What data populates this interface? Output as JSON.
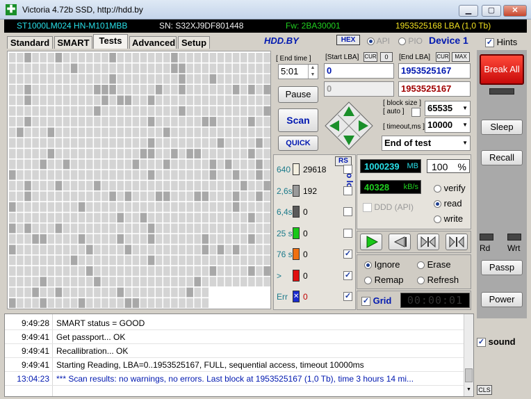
{
  "window": {
    "title": "Victoria 4.72b SSD, http://hdd.by"
  },
  "infobar": {
    "model": "ST1000LM024 HN-M101MBB",
    "serial": "SN: S32XJ9DF801448",
    "firmware": "Fw: 2BA30001",
    "capacity": "1953525168 LBA (1,0 Tb)"
  },
  "tabs": [
    "Standard",
    "SMART",
    "Tests",
    "Advanced",
    "Setup"
  ],
  "active_tab": "Tests",
  "header": {
    "site": "HDD.BY",
    "hex_label": "HEX",
    "api_label": "API",
    "pio_label": "PIO",
    "device_label": "Device 1",
    "hints_label": "Hints"
  },
  "test": {
    "end_time_label": "[ End time ]",
    "end_time_value": "5:01",
    "start_lba_label": "[Start LBA]",
    "cur_label": "CUR",
    "zero_label": "0",
    "end_lba_label": "[End LBA]",
    "max_label": "MAX",
    "start_lba_value": "0",
    "end_lba_value": "1953525167",
    "cur_lba_value": "0",
    "end_lba_value2": "1953525167",
    "pause_label": "Pause",
    "scan_label": "Scan",
    "quick_label": "QUICK",
    "block_size_label": "[ block size ]",
    "auto_label": "[ auto ]",
    "block_size_value": "65535",
    "timeout_label": "[ timeout,ms ]",
    "timeout_value": "10000",
    "end_action": "End of test"
  },
  "stats": {
    "rs_label": "RS",
    "to_log_label": "to log:",
    "rows": [
      {
        "label": "640",
        "count": "29618",
        "color": "#f4f0e0",
        "logged": false
      },
      {
        "label": "2,6s",
        "count": "192",
        "color": "#9a9a9a",
        "logged": false
      },
      {
        "label": "6,4s",
        "count": "0",
        "color": "#5a5a5a",
        "logged": false
      },
      {
        "label": "25 s",
        "count": "0",
        "color": "#19c819",
        "logged": false
      },
      {
        "label": "76 s",
        "count": "0",
        "color": "#f07010",
        "logged": true
      },
      {
        "label": ">",
        "count": "0",
        "color": "#e01010",
        "logged": true
      },
      {
        "label": "Err",
        "count": "0",
        "color": "#1a2bd0",
        "logged": true
      }
    ]
  },
  "progress": {
    "mb_value": "1000239",
    "mb_unit": "MB",
    "percent_value": "100",
    "percent_unit": "%",
    "speed_value": "40328",
    "speed_unit": "kB/s",
    "ddd_label": "DDD (API)"
  },
  "rw_mode": {
    "verify": "verify",
    "read": "read",
    "write": "write",
    "selected": "read"
  },
  "action_mode": {
    "ignore": "Ignore",
    "erase": "Erase",
    "remap": "Remap",
    "refresh": "Refresh",
    "selected": "Ignore"
  },
  "grid_toggle": {
    "label": "Grid",
    "timer": "00:00:01"
  },
  "right_buttons": {
    "break_all": "Break All",
    "sleep": "Sleep",
    "recall": "Recall",
    "rd": "Rd",
    "wrt": "Wrt",
    "passp": "Passp",
    "power": "Power",
    "sound": "sound",
    "cls": "CLS"
  },
  "log": [
    {
      "time": "9:49:28",
      "msg": "SMART status = GOOD",
      "highlight": false
    },
    {
      "time": "9:49:41",
      "msg": "Get passport... OK",
      "highlight": false
    },
    {
      "time": "9:49:41",
      "msg": "Recallibration... OK",
      "highlight": false
    },
    {
      "time": "9:49:41",
      "msg": "Starting Reading, LBA=0..1953525167, FULL, sequential access, timeout 10000ms",
      "highlight": false
    },
    {
      "time": "13:04:23",
      "msg": "*** Scan results: no warnings, no errors. Last block at 1953525167 (1,0 Tb), time 3 hours 14 mi...",
      "highlight": true
    }
  ],
  "colors": {
    "accent_blue": "#0018b0",
    "lcd_cyan": "#28e0e8",
    "lcd_green": "#20d020",
    "break_red": "#e01010"
  }
}
